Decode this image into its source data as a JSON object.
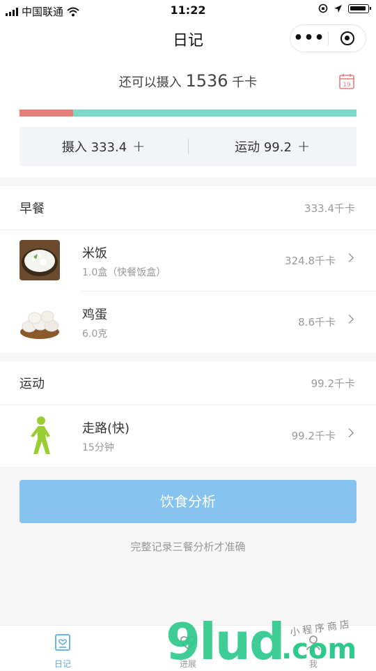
{
  "status": {
    "carrier": "中国联通",
    "time": "11:22"
  },
  "nav": {
    "title": "日记",
    "more": "•••"
  },
  "summary": {
    "remain_prefix": "还可以摄入",
    "remain_value": "1536",
    "remain_unit": "千卡",
    "calendar_day": "19",
    "progress_ratio": 0.16,
    "intake_label": "摄入 333.4",
    "exercise_label": "运动 99.2",
    "plus": "+"
  },
  "breakfast": {
    "title": "早餐",
    "total": "333.4千卡",
    "items": [
      {
        "name": "米饭",
        "detail": "1.0盒（快餐饭盒）",
        "cal": "324.8千卡"
      },
      {
        "name": "鸡蛋",
        "detail": "6.0克",
        "cal": "8.6千卡"
      }
    ]
  },
  "exercise": {
    "title": "运动",
    "total": "99.2千卡",
    "items": [
      {
        "name": "走路(快)",
        "detail": "15分钟",
        "cal": "99.2千卡"
      }
    ]
  },
  "analyze_button": "饮食分析",
  "hint": "完整记录三餐分析才准确",
  "tabs": [
    {
      "label": "日记",
      "icon": "diary-icon",
      "active": true
    },
    {
      "label": "进展",
      "icon": "progress-heart-icon",
      "active": false
    },
    {
      "label": "我",
      "icon": "profile-icon",
      "active": false
    }
  ],
  "watermark": {
    "main": "9lud",
    "domain": ".com",
    "tagline": "小程序商店"
  },
  "colors": {
    "accent": "#5aa9e6",
    "button": "#86c3ef",
    "progress_intake": "#e57d78",
    "progress_rest": "#7dd9c7",
    "calendar": "#e57d78",
    "walker": "#9acd32"
  }
}
